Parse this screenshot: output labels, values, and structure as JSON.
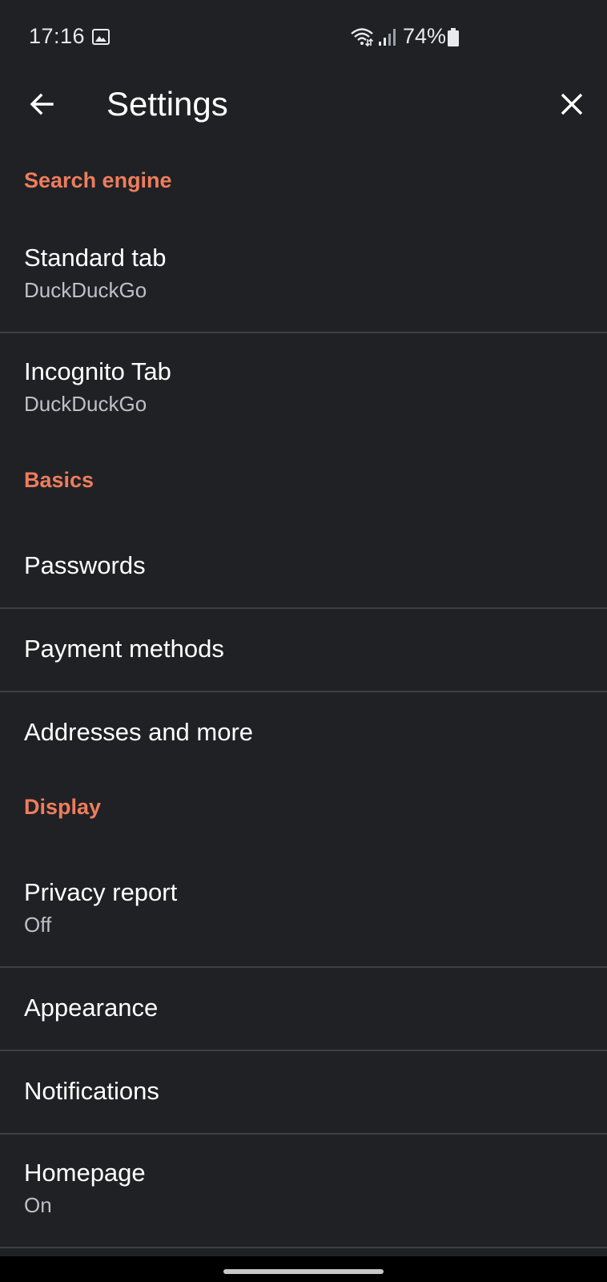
{
  "status_bar": {
    "time": "17:16",
    "battery": "74%",
    "icons": [
      "gallery-icon",
      "wifi-icon",
      "signal-icon",
      "battery-icon"
    ]
  },
  "app_bar": {
    "title": "Settings",
    "back_icon": "arrow-left-icon",
    "close_icon": "close-icon"
  },
  "sections": {
    "search_engine": {
      "header": "Search engine",
      "items": [
        {
          "title": "Standard tab",
          "subtitle": "DuckDuckGo"
        },
        {
          "title": "Incognito Tab",
          "subtitle": "DuckDuckGo"
        }
      ]
    },
    "basics": {
      "header": "Basics",
      "items": [
        {
          "title": "Passwords"
        },
        {
          "title": "Payment methods"
        },
        {
          "title": "Addresses and more"
        }
      ]
    },
    "display": {
      "header": "Display",
      "items": [
        {
          "title": "Privacy report",
          "subtitle": "Off"
        },
        {
          "title": "Appearance"
        },
        {
          "title": "Notifications"
        },
        {
          "title": "Homepage",
          "subtitle": "On"
        }
      ]
    }
  },
  "colors": {
    "background": "#202124",
    "section_header": "#ee7d5d",
    "divider": "#3c4043",
    "subtitle": "#bdc1c6"
  }
}
